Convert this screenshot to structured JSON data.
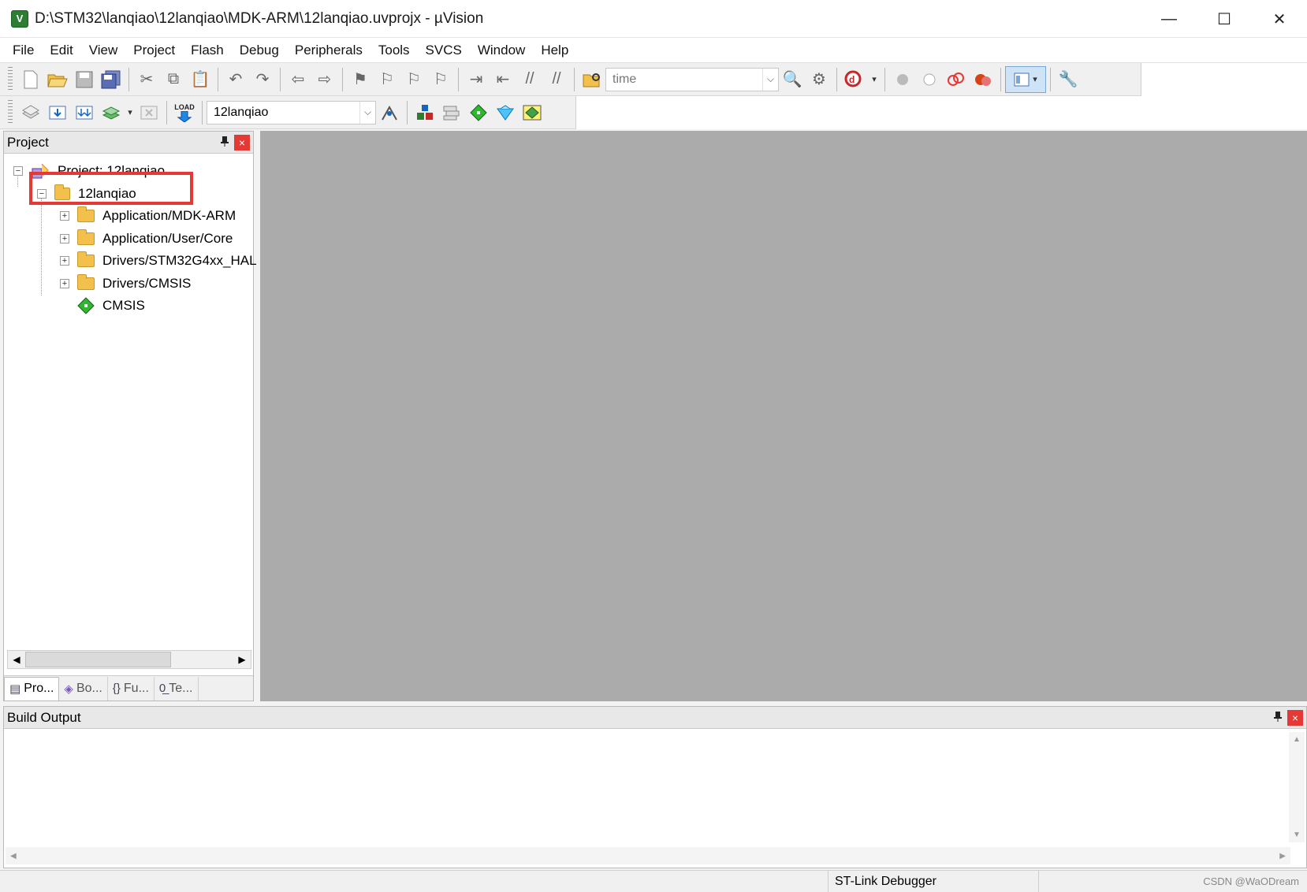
{
  "window": {
    "title": "D:\\STM32\\lanqiao\\12lanqiao\\MDK-ARM\\12lanqiao.uvprojx - µVision",
    "app_icon_text": "V",
    "minimize": "—",
    "maximize": "☐",
    "close": "✕"
  },
  "menu": [
    "File",
    "Edit",
    "View",
    "Project",
    "Flash",
    "Debug",
    "Peripherals",
    "Tools",
    "SVCS",
    "Window",
    "Help"
  ],
  "toolbar": {
    "find_combo_value": "time",
    "target_combo_value": "12lanqiao",
    "load_label": "LOAD"
  },
  "project_panel": {
    "title": "Project",
    "pin": "📌",
    "close": "×",
    "tree": {
      "root": "Project: 12lanqiao",
      "target": "12lanqiao",
      "groups": [
        "Application/MDK-ARM",
        "Application/User/Core",
        "Drivers/STM32G4xx_HAL",
        "Drivers/CMSIS"
      ],
      "component": "CMSIS"
    },
    "tabs": [
      {
        "label": "Pro...",
        "icon": "project-tab-icon"
      },
      {
        "label": "Bo...",
        "icon": "books-tab-icon"
      },
      {
        "label": "Fu...",
        "icon": "functions-tab-icon"
      },
      {
        "label": "Te...",
        "icon": "templates-tab-icon"
      }
    ]
  },
  "build_output": {
    "title": "Build Output",
    "pin": "📌",
    "close": "×"
  },
  "statusbar": {
    "debugger": "ST-Link Debugger",
    "watermark": "CSDN @WaODream"
  },
  "colors": {
    "highlight": "#e53935",
    "editor_bg": "#ababab"
  }
}
